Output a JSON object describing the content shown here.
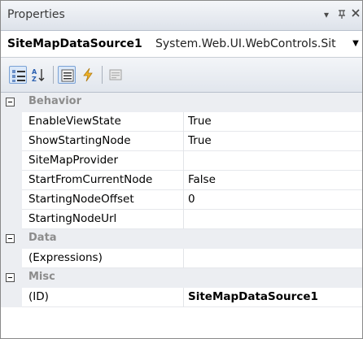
{
  "window": {
    "title": "Properties",
    "pin_glyph": "−I",
    "close_glyph": "✕"
  },
  "selector": {
    "object_name": "SiteMapDataSource1",
    "object_type": "System.Web.UI.WebControls.Sit"
  },
  "toolbar": {
    "buttons": [
      {
        "icon": "categorized-icon",
        "active": true
      },
      {
        "icon": "alphabetical-icon",
        "active": false
      },
      {
        "icon": "properties-icon",
        "active": true
      },
      {
        "icon": "events-icon",
        "active": false
      },
      {
        "icon": "property-pages-icon",
        "active": false
      }
    ]
  },
  "grid": {
    "categories": [
      {
        "label": "Behavior",
        "properties": [
          {
            "name": "EnableViewState",
            "value": "True"
          },
          {
            "name": "ShowStartingNode",
            "value": "True"
          },
          {
            "name": "SiteMapProvider",
            "value": ""
          },
          {
            "name": "StartFromCurrentNode",
            "value": "False"
          },
          {
            "name": "StartingNodeOffset",
            "value": "0"
          },
          {
            "name": "StartingNodeUrl",
            "value": ""
          }
        ]
      },
      {
        "label": "Data",
        "properties": [
          {
            "name": "(Expressions)",
            "value": ""
          }
        ]
      },
      {
        "label": "Misc",
        "properties": [
          {
            "name": "(ID)",
            "value": "SiteMapDataSource1",
            "bold": true
          }
        ]
      }
    ]
  }
}
